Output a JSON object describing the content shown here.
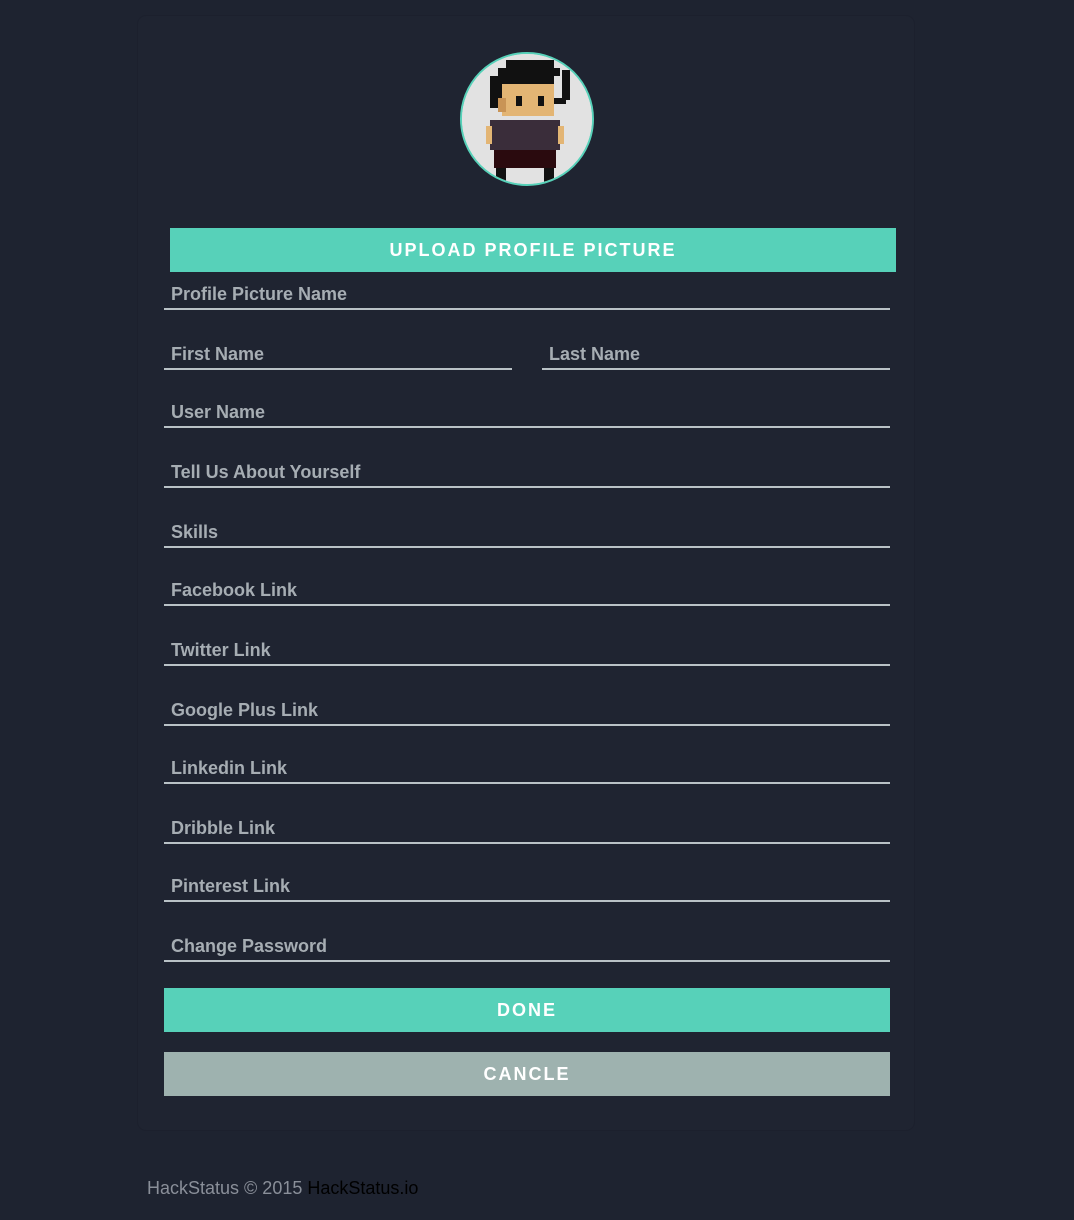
{
  "profile": {
    "avatar_icon": "pixel-character-avatar",
    "upload_label": "UPLOAD PROFILE PICTURE"
  },
  "form": {
    "profile_picture_name": "Profile Picture Name",
    "first_name": "First Name",
    "last_name": "Last Name",
    "user_name": "User Name",
    "about": "Tell Us About Yourself",
    "skills": "Skills",
    "facebook": "Facebook Link",
    "twitter": "Twitter Link",
    "google_plus": "Google Plus Link",
    "linkedin": "Linkedin Link",
    "dribble": "Dribble Link",
    "pinterest": "Pinterest Link",
    "password": "Change Password"
  },
  "actions": {
    "done_label": "DONE",
    "cancel_label": "CANCLE"
  },
  "footer": {
    "text": "HackStatus © 2015",
    "link_label": "HackStatus.io"
  },
  "colors": {
    "background": "#1e2330",
    "accent": "#57d1b9",
    "cancel": "#9eb2af"
  }
}
